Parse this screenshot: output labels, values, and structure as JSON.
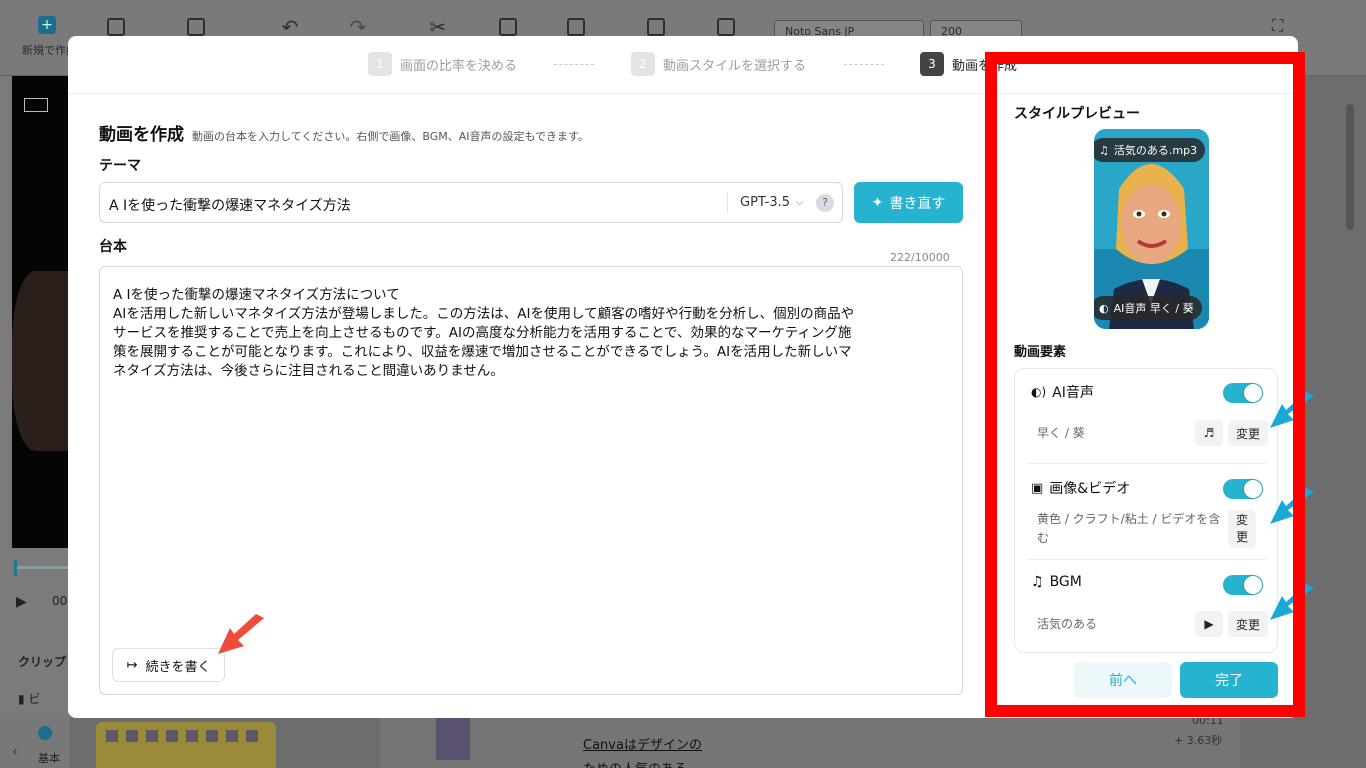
{
  "background": {
    "new_label": "新規で作成",
    "font_name": "Noto Sans JP",
    "font_size": "200",
    "clip_label": "クリップ",
    "clip_item": "ビ",
    "time_readout": "00",
    "bottom_label": "基本",
    "timeline_text_1": "Canvaはデザインの",
    "timeline_text_2": "ための人気のある",
    "timeline_time": "00:11",
    "timeline_duration": "+ 3.63秒"
  },
  "stepper": {
    "step1": {
      "num": "1",
      "label": "画面の比率を決める"
    },
    "step2": {
      "num": "2",
      "label": "動画スタイルを選択する"
    },
    "step3": {
      "num": "3",
      "label": "動画を作成"
    }
  },
  "main": {
    "title": "動画を作成",
    "subtitle": "動画の台本を入力してください。右側で画像、BGM、AI音声の設定もできます。",
    "theme_label": "テーマ",
    "theme_value": "A Iを使った衝撃の爆速マネタイズ方法",
    "model": "GPT-3.5",
    "help": "?",
    "rewrite_button": "書き直す",
    "script_label": "台本",
    "char_count": "222/10000",
    "script_lines": [
      "A Iを使った衝撃の爆速マネタイズ方法について",
      "AIを活用した新しいマネタイズ方法が登場しました。この方法は、AIを使用して顧客の嗜好や行動を分析し、個別の商品や",
      "サービスを推奨することで売上を向上させるものです。AIの高度な分析能力を活用することで、効果的なマーケティング施",
      "策を展開することが可能となります。これにより、収益を爆速で増加させることができるでしょう。AIを活用した新しいマ",
      "ネタイズ方法は、今後さらに注目されること間違いありません。"
    ],
    "continue_button": "続きを書く"
  },
  "preview": {
    "title": "スタイルプレビュー",
    "music_pill": "活気のある.mp3",
    "voice_pill": "AI音声  早く / 葵"
  },
  "elements": {
    "title": "動画要素",
    "ai_voice": {
      "label": "AI音声",
      "value": "早く / 葵",
      "change": "変更"
    },
    "image_video": {
      "label": "画像&ビデオ",
      "value_line1": "黄色 / クラフト/粘土 / ビデオを含",
      "value_line2": "む",
      "change_line1": "変",
      "change_line2": "更"
    },
    "bgm": {
      "label": "BGM",
      "value": "活気のある",
      "change": "変更"
    }
  },
  "footer": {
    "prev": "前へ",
    "done": "完了"
  },
  "colors": {
    "accent": "#26b3d0",
    "highlight": "#ff0000",
    "arrow_red": "#f04a3a",
    "arrow_blue": "#1aa7d9"
  }
}
